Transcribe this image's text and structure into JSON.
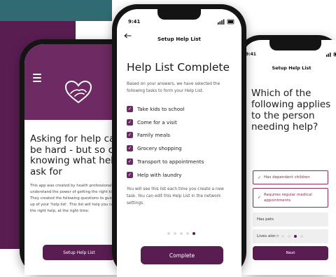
{
  "colors": {
    "brand_purple": "#5a1d52",
    "hero_purple": "#6e2a63",
    "teal": "#2f6b70",
    "accent_red": "#8a2d4f"
  },
  "left_screen": {
    "headline": "Asking for help can be hard - but so can knowing what help to ask for",
    "body": "This app was created by health professionals who understand the power of getting the right kind of help. They created the following questions to guide the set-up of your 'help list'. This list will help you coordinate the right help, at the right time.",
    "button_label": "Setup Help List",
    "hero_icon": "heart-hands-icon",
    "menu_icon": "hamburger-icon"
  },
  "middle_screen": {
    "time": "9:41",
    "status_icons": "signal wifi battery",
    "back_icon": "back-arrow-icon",
    "header": "Setup Help List",
    "title": "Help List Complete",
    "intro": "Based on your answers, we have selected the following tasks to form your Help List.",
    "tasks": [
      {
        "label": "Take kids to school",
        "checked": true
      },
      {
        "label": "Come for a visit",
        "checked": true
      },
      {
        "label": "Family meals",
        "checked": true
      },
      {
        "label": "Grocery shopping",
        "checked": true
      },
      {
        "label": "Transport to appointments",
        "checked": true
      },
      {
        "label": "Help with laundry",
        "checked": true
      }
    ],
    "note": "You will see this list each time you create a new task. You can edit this Help List in the network settings.",
    "pagination": {
      "total": 5,
      "active": 5
    },
    "button_label": "Complete"
  },
  "right_screen": {
    "time": "9:41",
    "header": "Setup Help List",
    "question": "Which of the following applies to the person needing help?",
    "options": [
      {
        "label": "Has dependent children",
        "selected": true
      },
      {
        "label": "Requires regular medical appointments",
        "selected": true
      },
      {
        "label": "Has pets",
        "selected": false
      },
      {
        "label": "Lives alone",
        "selected": false
      }
    ],
    "pagination": {
      "total": 5,
      "active": 4
    },
    "button_label": "Next"
  }
}
